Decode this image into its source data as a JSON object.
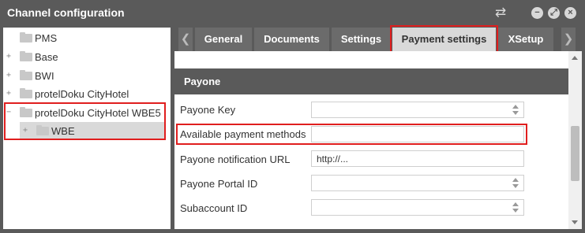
{
  "window": {
    "title": "Channel configuration",
    "icons": [
      "swap-icon",
      "minimize-icon",
      "maximize-icon",
      "close-icon"
    ]
  },
  "tree": {
    "items": [
      {
        "label": "PMS",
        "level": 0,
        "expander": "",
        "selected": false
      },
      {
        "label": "Base",
        "level": 0,
        "expander": "+",
        "selected": false
      },
      {
        "label": "BWI",
        "level": 0,
        "expander": "+",
        "selected": false
      },
      {
        "label": "protelDoku CityHotel",
        "level": 0,
        "expander": "+",
        "selected": false
      },
      {
        "label": "protelDoku CityHotel WBE5",
        "level": 0,
        "expander": "−",
        "selected": false
      },
      {
        "label": "WBE",
        "level": 1,
        "expander": "+",
        "selected": true
      }
    ]
  },
  "tabs": {
    "prev_arrow": "❮",
    "next_arrow": "❯",
    "items": [
      {
        "label": "General",
        "active": false
      },
      {
        "label": "Documents",
        "active": false
      },
      {
        "label": "Settings",
        "active": false
      },
      {
        "label": "Payment settings",
        "active": true
      },
      {
        "label": "XSetup",
        "active": false
      }
    ]
  },
  "section": {
    "title": "Payone",
    "fields": [
      {
        "label": "Payone Key",
        "value": "",
        "type": "spinner"
      },
      {
        "label": "Available payment methods",
        "value": "",
        "type": "text"
      },
      {
        "label": "Payone notification URL",
        "value": "http://...",
        "type": "text"
      },
      {
        "label": "Payone Portal ID",
        "value": "",
        "type": "spinner"
      },
      {
        "label": "Subaccount ID",
        "value": "",
        "type": "spinner"
      }
    ]
  },
  "colors": {
    "highlight": "#e01e1e",
    "header_bg": "#5a5a5a",
    "active_tab_bg": "#d9d9d9"
  }
}
